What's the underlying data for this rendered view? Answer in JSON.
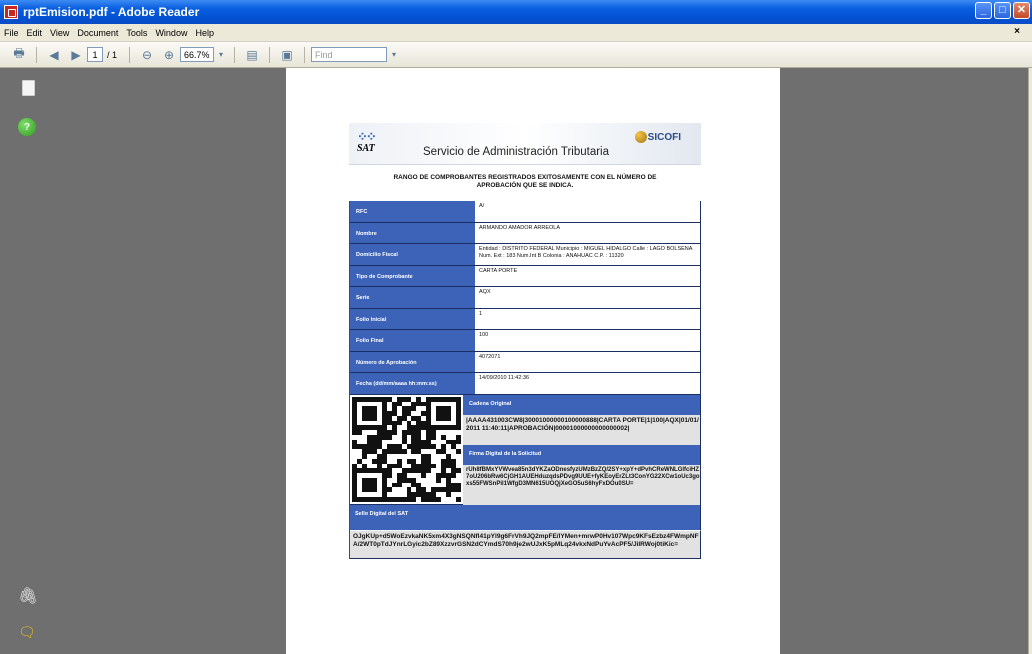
{
  "window": {
    "title": "rptEmision.pdf - Adobe Reader"
  },
  "menu": [
    "File",
    "Edit",
    "View",
    "Document",
    "Tools",
    "Window",
    "Help"
  ],
  "toolbar": {
    "page_current": "1",
    "page_total": "/ 1",
    "zoom": "66.7%",
    "find_placeholder": "Find"
  },
  "document": {
    "header_title": "Servicio de Administración Tributaria",
    "sat_logo_text": "SAT",
    "sicofi_logo_text": "SICOFI",
    "heading": "RANGO DE COMPROBANTES REGISTRADOS EXITOSAMENTE CON EL NÚMERO DE APROBACIÓN QUE SE INDICA.",
    "rows": [
      {
        "label": "RFC",
        "value": "A/"
      },
      {
        "label": "Nombre",
        "value": "ARMANDO AMADOR ARREOLA"
      },
      {
        "label": "Domicilio Fiscal",
        "value": "Entidad : DISTRITO FEDERAL Municipio : MIGUEL HIDALGO Calle : LAGO BOLSENA Num. Ext : 183 Num.Int B Colonia : ANAHUAC C.P. : 11320"
      },
      {
        "label": "Tipo de Comprobante",
        "value": "CARTA PORTE"
      },
      {
        "label": "Serie",
        "value": "AQX"
      },
      {
        "label": "Folio Inicial",
        "value": "1"
      },
      {
        "label": "Folio Final",
        "value": "100"
      },
      {
        "label": "Número de Aprobación",
        "value": "4072071"
      },
      {
        "label": "Fecha (dd/mm/aaaa hh:mm:ss)",
        "value": "14/09/2010 11:42:36"
      }
    ],
    "cadena_label": "Cadena Original",
    "cadena_value": "|AAAA431003CW8|30001000000100000888|CARTA PORTE|1|100|AQX|01/01/2011 11:40:11|APROBACIÓN|00001000000000000002|",
    "firma_label": "Firma Digital de la Solicitud",
    "firma_value": "rUh8fBMxYVWvea85n3dYKZaODnesfyzUMzBzZQ/2SY+xpY+dPvhCReWNLGlfciHZ7oU206bRw6CjGH1AUEHduzqdsPDvg9UUE+fyKEoyErZLt3ConYG22XCw1oUc3goxs55FWSnPil1WfgD3MN615UOQjXeGO5uS6hyFxDOu0SU=",
    "sello_label": "Sello Digital del SAT",
    "sello_value": "OJgKUp+d5WoEzvkaNK5xm4X3gNSQNfl41pYl9g6FrVh9JQ2mpFE/lYMen+mrwP0Hv107Wpc9KFsEzbz4FWmpNFA/2WT0pTdJYnrLGyic2bZ89XzzvrGSN2dCYmdS70h9je2wUJxK5pMLq24vkxNdPuYvAcPF5/JilRWoj0tiKic="
  }
}
